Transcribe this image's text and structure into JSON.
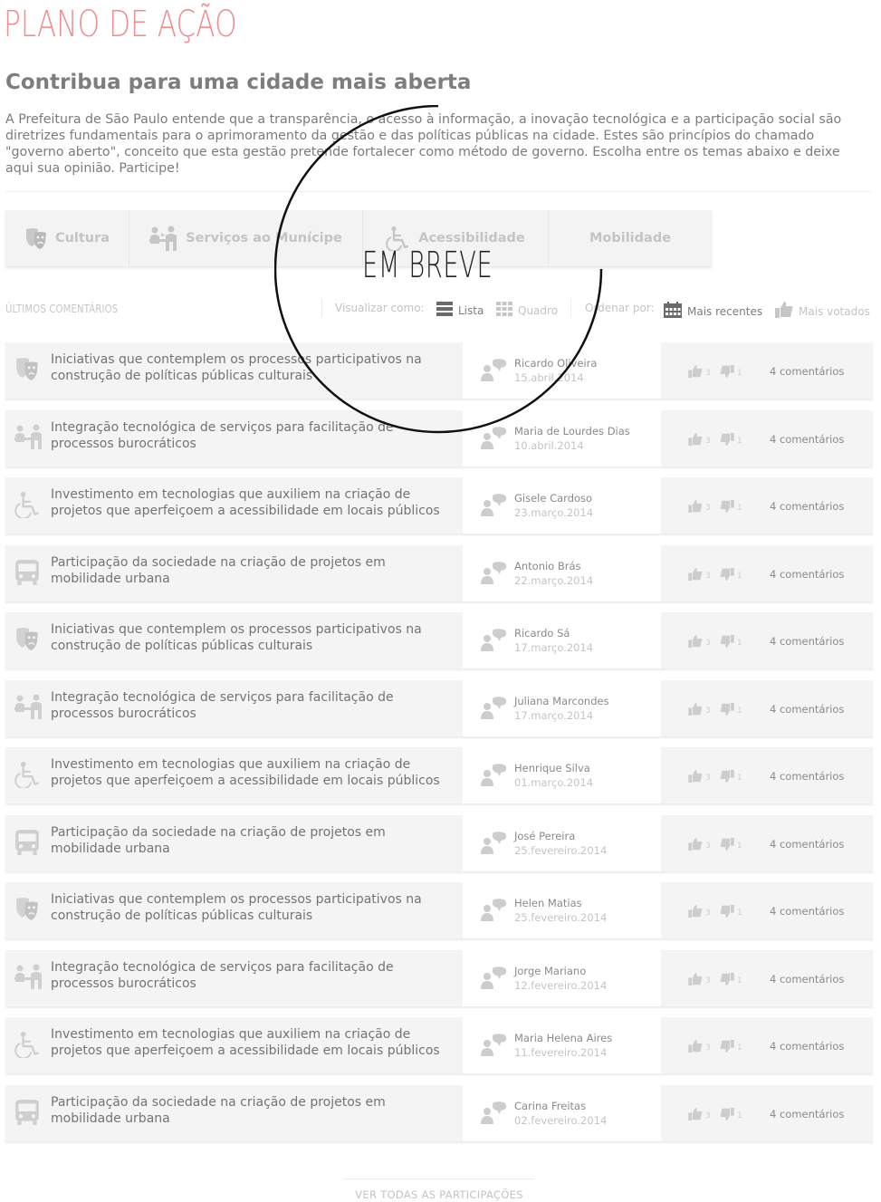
{
  "header": {
    "title": "PLANO DE AÇÃO",
    "subtitle": "Contribua para uma cidade mais aberta",
    "intro": "A Prefeitura de São Paulo entende que a transparência, o acesso à informação, a inovação tecnológica e a participação social são diretrizes fundamentais para o aprimoramento da gestão e das políticas públicas na cidade. Estes são princípios do chamado \"governo aberto\", conceito que esta gestão pretende fortalecer como método de governo. Escolha entre os temas abaixo e deixe aqui sua opinião. Participe!"
  },
  "themes": [
    {
      "label": "Cultura",
      "icon": "theater-masks-icon"
    },
    {
      "label": "Serviços ao Munícipe",
      "icon": "people-service-icon"
    },
    {
      "label": "Acessibilidade",
      "icon": "wheelchair-icon"
    },
    {
      "label": "Mobilidade",
      "icon": ""
    }
  ],
  "overlay": {
    "label": "EM BREVE"
  },
  "toolbar": {
    "section_label": "ÚLTIMOS COMENTÁRIOS",
    "view_label": "Visualizar como:",
    "view_list": "Lista",
    "view_grid": "Quadro",
    "sort_label": "Ordenar por:",
    "sort_recent": "Mais recentes",
    "sort_voted": "Mais votados"
  },
  "colors": {
    "accent": "#ee8f91",
    "muted": "#c4c4c4",
    "text": "#737373"
  },
  "rows": [
    {
      "category": "cultura",
      "title": "Iniciativas que contemplem os processos participativos na construção de políticas públicas culturais",
      "user": "Ricardo Oliveira",
      "date": "15.abril.2014",
      "likes": "3",
      "dislikes": "1",
      "comments": "4 comentários"
    },
    {
      "category": "servicos",
      "title": "Integração tecnológica de serviços para facilitação de processos burocráticos",
      "user": "Maria de Lourdes Dias",
      "date": "10.abril.2014",
      "likes": "3",
      "dislikes": "1",
      "comments": "4 comentários"
    },
    {
      "category": "acessibilidade",
      "title": "Investimento em tecnologias que auxiliem na criação de projetos que aperfeiçoem a acessibilidade em locais públicos",
      "user": "Gisele Cardoso",
      "date": "23.março.2014",
      "likes": "3",
      "dislikes": "1",
      "comments": "4 comentários"
    },
    {
      "category": "mobilidade",
      "title": "Participação da sociedade na criação de projetos em mobilidade urbana",
      "user": "Antonio Brás",
      "date": "22.março.2014",
      "likes": "3",
      "dislikes": "1",
      "comments": "4 comentários"
    },
    {
      "category": "cultura",
      "title": "Iniciativas que contemplem os processos participativos na construção de políticas públicas culturais",
      "user": "Ricardo Sá",
      "date": "17.março.2014",
      "likes": "3",
      "dislikes": "1",
      "comments": "4 comentários"
    },
    {
      "category": "servicos",
      "title": "Integração tecnológica de serviços para facilitação de processos burocráticos",
      "user": "Juliana Marcondes",
      "date": "17.março.2014",
      "likes": "3",
      "dislikes": "1",
      "comments": "4 comentários"
    },
    {
      "category": "acessibilidade",
      "title": "Investimento em tecnologias que auxiliem na criação de projetos que aperfeiçoem a acessibilidade em locais públicos",
      "user": "Henrique Silva",
      "date": "01.março.2014",
      "likes": "3",
      "dislikes": "1",
      "comments": "4 comentários"
    },
    {
      "category": "mobilidade",
      "title": "Participação da sociedade na criação de projetos em mobilidade urbana",
      "user": "José Pereira",
      "date": "25.fevereiro.2014",
      "likes": "3",
      "dislikes": "1",
      "comments": "4 comentários"
    },
    {
      "category": "cultura",
      "title": "Iniciativas que contemplem os processos participativos na construção de políticas públicas culturais",
      "user": "Helen Matias",
      "date": "25.fevereiro.2014",
      "likes": "3",
      "dislikes": "1",
      "comments": "4 comentários"
    },
    {
      "category": "servicos",
      "title": "Integração tecnológica de serviços para facilitação de processos burocráticos",
      "user": "Jorge Mariano",
      "date": "12.fevereiro.2014",
      "likes": "3",
      "dislikes": "1",
      "comments": "4 comentários"
    },
    {
      "category": "acessibilidade",
      "title": "Investimento em tecnologias que auxiliem na criação de projetos que aperfeiçoem a acessibilidade em locais públicos",
      "user": "Maria Helena Aires",
      "date": "11.fevereiro.2014",
      "likes": "3",
      "dislikes": "1",
      "comments": "4 comentários"
    },
    {
      "category": "mobilidade",
      "title": "Participação da sociedade na criação de projetos em mobilidade urbana",
      "user": "Carina Freitas",
      "date": "02.fevereiro.2014",
      "likes": "3",
      "dislikes": "1",
      "comments": "4 comentários"
    }
  ],
  "footer": {
    "link": "VER TODAS AS PARTICIPAÇÕES"
  }
}
